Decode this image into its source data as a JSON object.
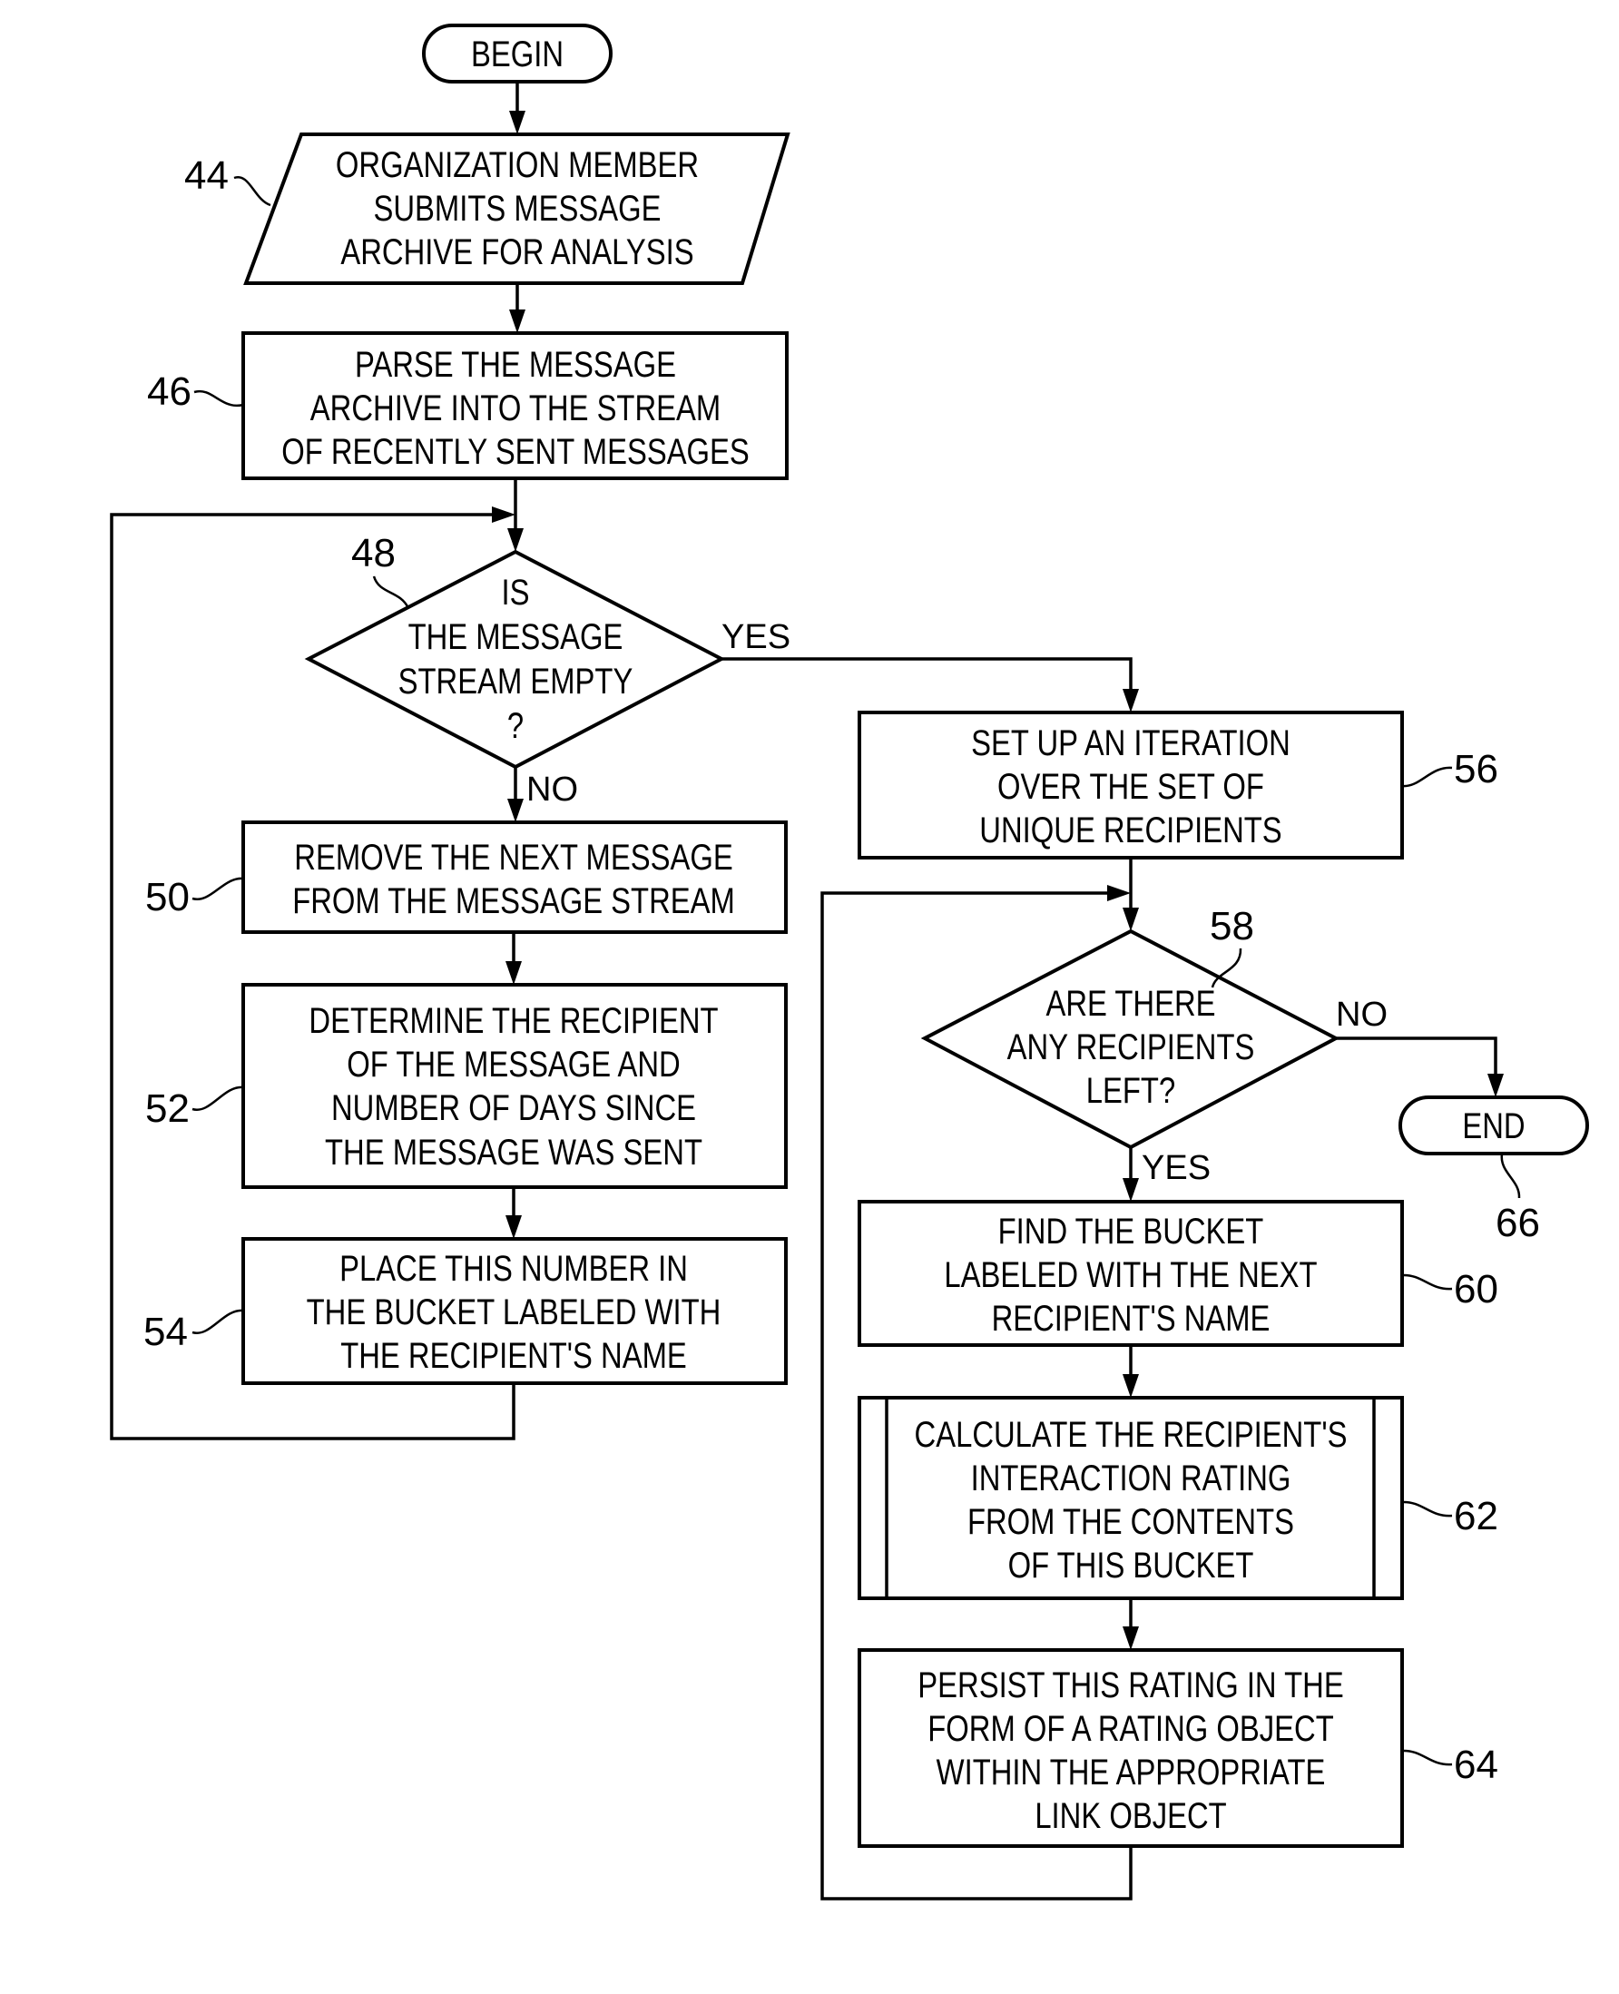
{
  "flowchart": {
    "begin": "BEGIN",
    "end": "END",
    "steps": {
      "s44": {
        "ref": "44",
        "lines": [
          "ORGANIZATION MEMBER",
          "SUBMITS MESSAGE",
          "ARCHIVE FOR ANALYSIS"
        ]
      },
      "s46": {
        "ref": "46",
        "lines": [
          "PARSE THE MESSAGE",
          "ARCHIVE INTO THE STREAM",
          "OF RECENTLY SENT MESSAGES"
        ]
      },
      "s48": {
        "ref": "48",
        "lines": [
          "IS",
          "THE MESSAGE",
          "STREAM EMPTY",
          "?"
        ]
      },
      "s50": {
        "ref": "50",
        "lines": [
          "REMOVE THE NEXT MESSAGE",
          "FROM THE MESSAGE STREAM"
        ]
      },
      "s52": {
        "ref": "52",
        "lines": [
          "DETERMINE THE RECIPIENT",
          "OF THE MESSAGE AND",
          "NUMBER OF DAYS SINCE",
          "THE MESSAGE WAS SENT"
        ]
      },
      "s54": {
        "ref": "54",
        "lines": [
          "PLACE THIS NUMBER IN",
          "THE BUCKET LABELED WITH",
          "THE RECIPIENT'S NAME"
        ]
      },
      "s56": {
        "ref": "56",
        "lines": [
          "SET UP AN ITERATION",
          "OVER THE SET OF",
          "UNIQUE RECIPIENTS"
        ]
      },
      "s58": {
        "ref": "58",
        "lines": [
          "ARE THERE",
          "ANY RECIPIENTS",
          "LEFT?"
        ]
      },
      "s60": {
        "ref": "60",
        "lines": [
          "FIND THE BUCKET",
          "LABELED WITH THE NEXT",
          "RECIPIENT'S NAME"
        ]
      },
      "s62": {
        "ref": "62",
        "lines": [
          "CALCULATE THE RECIPIENT'S",
          "INTERACTION RATING",
          "FROM THE CONTENTS",
          "OF THIS BUCKET"
        ]
      },
      "s64": {
        "ref": "64",
        "lines": [
          "PERSIST THIS RATING IN THE",
          "FORM OF A RATING OBJECT",
          "WITHIN THE APPROPRIATE",
          "LINK OBJECT"
        ]
      },
      "s66": {
        "ref": "66"
      }
    },
    "branches": {
      "d48_yes": "YES",
      "d48_no": "NO",
      "d58_no": "NO",
      "d58_yes": "YES"
    }
  }
}
